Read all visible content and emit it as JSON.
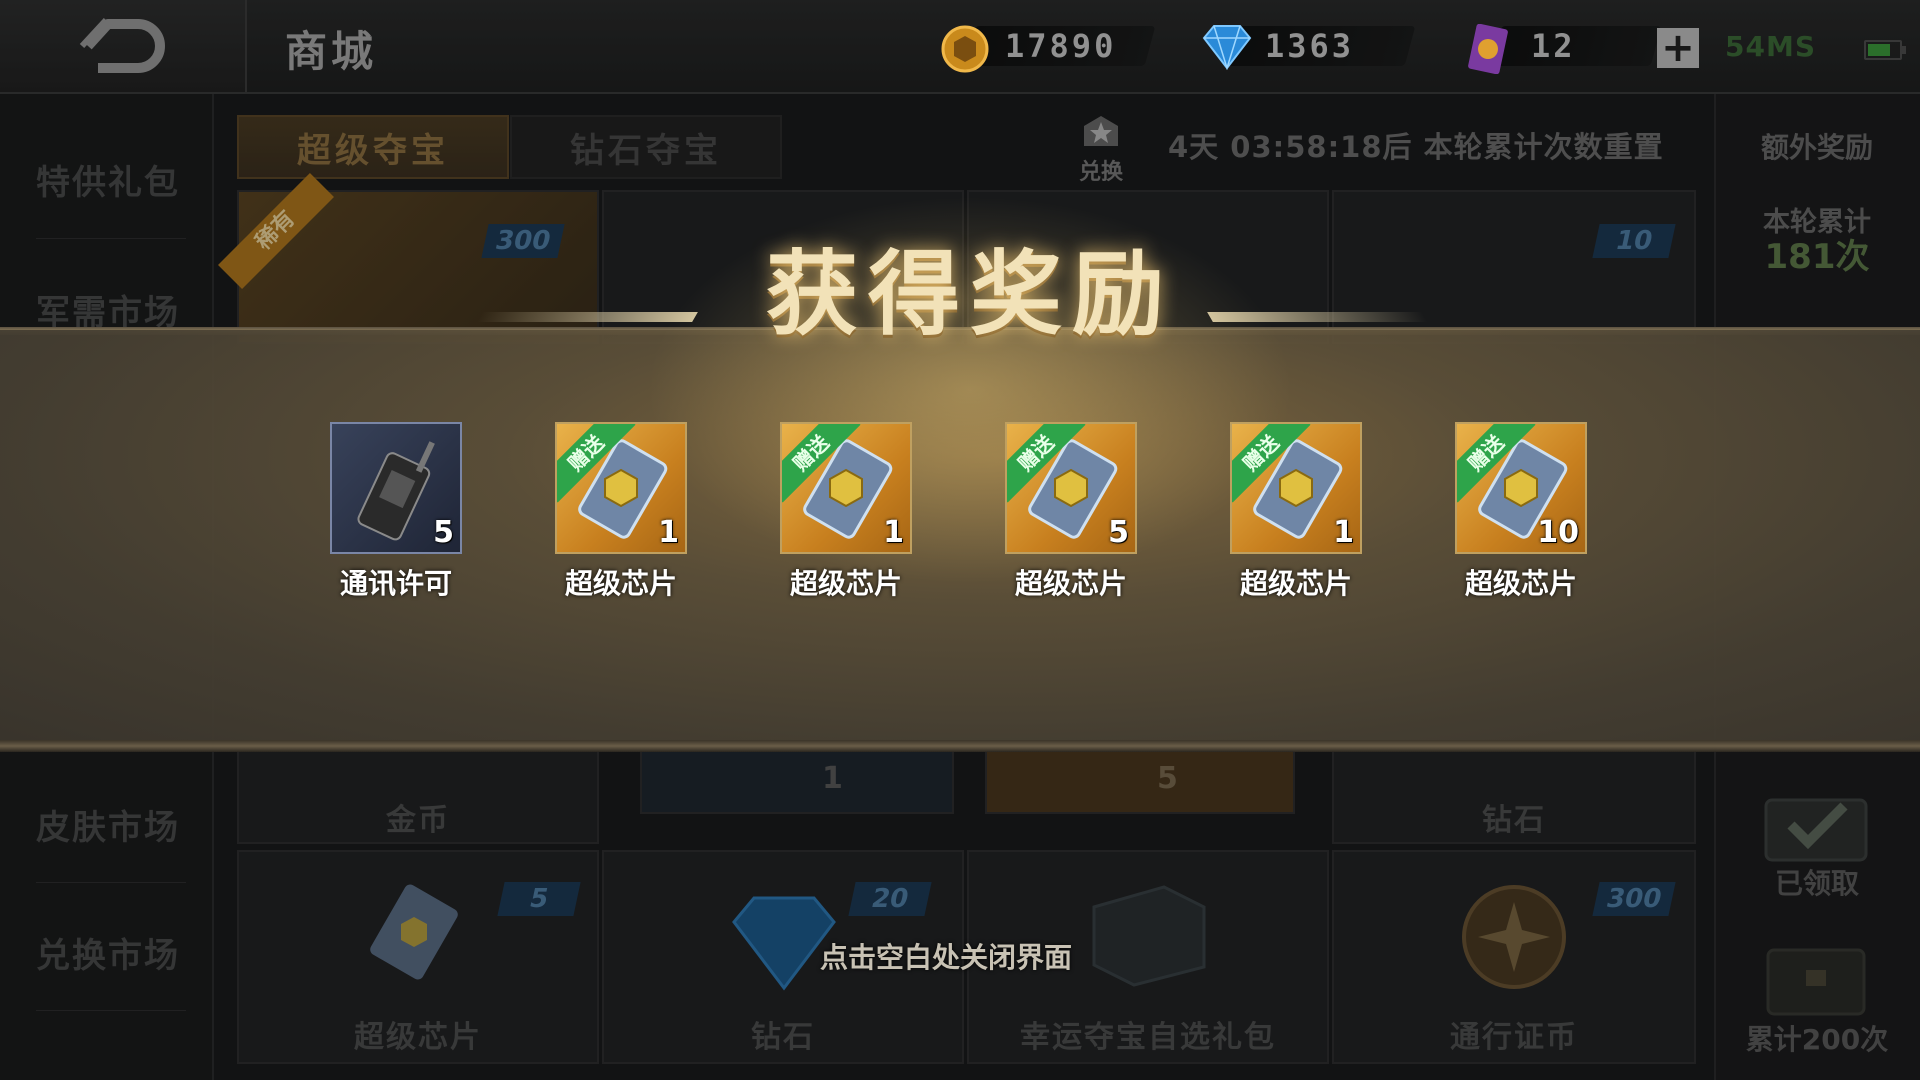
{
  "header": {
    "title": "商城",
    "gold": "17890",
    "diamond": "1363",
    "ticket": "12",
    "plus": "+",
    "ping": "54MS"
  },
  "sidebar": {
    "items": [
      {
        "label": "特供礼包"
      },
      {
        "label": "军需市场"
      },
      {
        "label": "皮肤市场"
      },
      {
        "label": "兑换市场"
      }
    ]
  },
  "tabs": {
    "active": "超级夺宝",
    "inactive": "钻石夺宝"
  },
  "exchange_label": "兑换",
  "timer_text": "4天 03:58:18后 本轮累计次数重置",
  "right_panel": {
    "title": "额外奖励",
    "round_label": "本轮累计",
    "round_count": "181次",
    "claimed": "已领取",
    "total": "累计200次"
  },
  "grid": {
    "top_row": [
      {
        "badge": "稀有",
        "qty": "300"
      },
      {
        "qty": ""
      },
      {
        "qty": ""
      },
      {
        "qty": "10"
      }
    ],
    "middle_row": [
      {
        "label": "金币"
      },
      {
        "qty": "1"
      },
      {
        "qty": "5"
      },
      {
        "label": "钻石"
      }
    ],
    "bottom_row": [
      {
        "label": "超级芯片",
        "qty": "5"
      },
      {
        "label": "钻石",
        "qty": "20"
      },
      {
        "label": "幸运夺宝自选礼包",
        "qty": ""
      },
      {
        "label": "通行证币",
        "qty": "300"
      }
    ]
  },
  "overlay": {
    "title": "获得奖励",
    "close_hint": "点击空白处关闭界面",
    "rewards": [
      {
        "name": "通讯许可",
        "count": "5",
        "gift": ""
      },
      {
        "name": "超级芯片",
        "count": "1",
        "gift": "赠送"
      },
      {
        "name": "超级芯片",
        "count": "1",
        "gift": "赠送"
      },
      {
        "name": "超级芯片",
        "count": "5",
        "gift": "赠送"
      },
      {
        "name": "超级芯片",
        "count": "1",
        "gift": "赠送"
      },
      {
        "name": "超级芯片",
        "count": "10",
        "gift": "赠送"
      }
    ]
  },
  "colors": {
    "accent_gold": "#c8801f",
    "gift_green": "#2ea44a",
    "qty_blue": "#1d3a55"
  }
}
